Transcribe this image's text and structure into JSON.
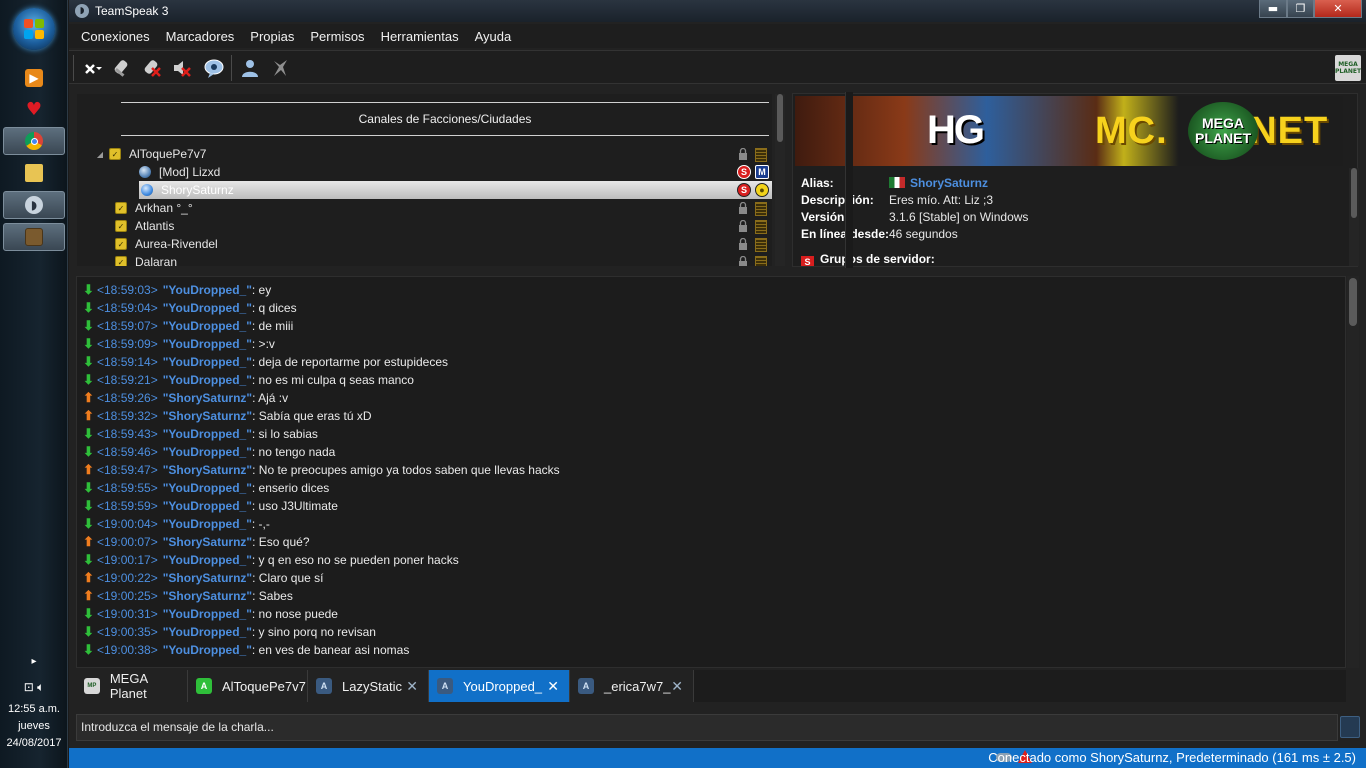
{
  "taskbar": {
    "clock_time": "12:55 a.m.",
    "clock_day": "jueves",
    "clock_date": "24/08/2017"
  },
  "window": {
    "title": "TeamSpeak 3",
    "min_glyph": "▬",
    "max_glyph": "❐",
    "close_glyph": "✕"
  },
  "menu": [
    "Conexiones",
    "Marcadores",
    "Propias",
    "Permisos",
    "Herramientas",
    "Ayuda"
  ],
  "toolbar": {
    "icons": [
      "disconnect-icon",
      "away-icon",
      "mute-microphone-icon",
      "mute-speakers-icon",
      "subscribe-icon",
      "contacts-icon",
      "whisper-icon"
    ],
    "server_icon": "mega-planet-icon",
    "server_icon_text": "MEGA PLANET"
  },
  "tree": {
    "spacer_title": "Canales de Facciones/Ciudades",
    "rows": [
      {
        "label": "AlToquePe7v7",
        "kind": "channel"
      },
      {
        "label": "[Mod] Lizxd",
        "kind": "client",
        "badge_a": "S",
        "badge_b": "M"
      },
      {
        "label": "ShorySaturnz",
        "kind": "client",
        "selected": true,
        "badge_a": "S",
        "badge_b": "●"
      },
      {
        "label": "Arkhan °_°",
        "kind": "channel"
      },
      {
        "label": "Atlantis",
        "kind": "channel"
      },
      {
        "label": "Aurea-Rivendel",
        "kind": "channel"
      },
      {
        "label": "Dalaran",
        "kind": "channel"
      }
    ]
  },
  "info": {
    "banner_hg": "HG",
    "banner_mc": "MC.",
    "banner_mega": "MEGA",
    "banner_planet": "PLANET",
    "banner_net": ".NET",
    "alias_label": "Alias:",
    "alias_value": "ShorySaturnz",
    "desc_label": "Descripción:",
    "desc_value": "Eres mío. Att: Liz ;3",
    "version_label": "Versión:",
    "version_value": "3.1.6 [Stable] on Windows",
    "online_label": "En línea desde:",
    "online_value": "46 segundos",
    "groups_label": "Grupos de servidor:",
    "groups_icon_text": "S"
  },
  "chat": {
    "messages": [
      {
        "dir": "in",
        "time": "<18:59:03>",
        "nick": "\"YouDropped_\"",
        "text": ": ey"
      },
      {
        "dir": "in",
        "time": "<18:59:04>",
        "nick": "\"YouDropped_\"",
        "text": ": q dices"
      },
      {
        "dir": "in",
        "time": "<18:59:07>",
        "nick": "\"YouDropped_\"",
        "text": ": de miii"
      },
      {
        "dir": "in",
        "time": "<18:59:09>",
        "nick": "\"YouDropped_\"",
        "text": ": >:v"
      },
      {
        "dir": "in",
        "time": "<18:59:14>",
        "nick": "\"YouDropped_\"",
        "text": ": deja de reportarme por estupideces"
      },
      {
        "dir": "in",
        "time": "<18:59:21>",
        "nick": "\"YouDropped_\"",
        "text": ": no es mi culpa q seas manco"
      },
      {
        "dir": "out",
        "time": "<18:59:26>",
        "nick": "\"ShorySaturnz\"",
        "text": ": Ajá :v"
      },
      {
        "dir": "out",
        "time": "<18:59:32>",
        "nick": "\"ShorySaturnz\"",
        "text": ": Sabía que eras tú xD"
      },
      {
        "dir": "in",
        "time": "<18:59:43>",
        "nick": "\"YouDropped_\"",
        "text": ": si lo sabias"
      },
      {
        "dir": "in",
        "time": "<18:59:46>",
        "nick": "\"YouDropped_\"",
        "text": ": no tengo nada"
      },
      {
        "dir": "out",
        "time": "<18:59:47>",
        "nick": "\"ShorySaturnz\"",
        "text": ": No te preocupes amigo ya todos saben que llevas hacks"
      },
      {
        "dir": "in",
        "time": "<18:59:55>",
        "nick": "\"YouDropped_\"",
        "text": ": enserio dices"
      },
      {
        "dir": "in",
        "time": "<18:59:59>",
        "nick": "\"YouDropped_\"",
        "text": ": uso J3Ultimate"
      },
      {
        "dir": "in",
        "time": "<19:00:04>",
        "nick": "\"YouDropped_\"",
        "text": ": -,-"
      },
      {
        "dir": "out",
        "time": "<19:00:07>",
        "nick": "\"ShorySaturnz\"",
        "text": ": Eso qué?"
      },
      {
        "dir": "in",
        "time": "<19:00:17>",
        "nick": "\"YouDropped_\"",
        "text": ": y q en eso no se pueden poner hacks"
      },
      {
        "dir": "out",
        "time": "<19:00:22>",
        "nick": "\"ShorySaturnz\"",
        "text": ": Claro que sí"
      },
      {
        "dir": "out",
        "time": "<19:00:25>",
        "nick": "\"ShorySaturnz\"",
        "text": ": Sabes"
      },
      {
        "dir": "in",
        "time": "<19:00:31>",
        "nick": "\"YouDropped_\"",
        "text": ": no nose puede"
      },
      {
        "dir": "in",
        "time": "<19:00:35>",
        "nick": "\"YouDropped_\"",
        "text": ": y sino porq no revisan"
      },
      {
        "dir": "in",
        "time": "<19:00:38>",
        "nick": "\"YouDropped_\"",
        "text": ": en ves de banear asi nomas"
      }
    ]
  },
  "tabs": [
    {
      "label": "MEGA Planet",
      "icon": "server-icon",
      "closable": false
    },
    {
      "label": "AlToquePe7v7",
      "icon": "channel-icon",
      "closable": false
    },
    {
      "label": "LazyStatic",
      "icon": "private-chat-icon",
      "closable": true
    },
    {
      "label": "YouDropped_",
      "icon": "private-chat-icon",
      "closable": true,
      "active": true
    },
    {
      "label": "_erica7w7_",
      "icon": "private-chat-icon",
      "closable": true
    }
  ],
  "tab_close_glyph": "✕",
  "input": {
    "placeholder": "Introduzca el mensaje de la charla..."
  },
  "status": {
    "text": "Conectado como ShorySaturnz, Predeterminado (161 ms ± 2.5)"
  },
  "colors": {
    "accent": "#1170c8",
    "nick": "#4d8fe0",
    "incoming": "#2fbf3a",
    "outgoing": "#f07d1e"
  }
}
